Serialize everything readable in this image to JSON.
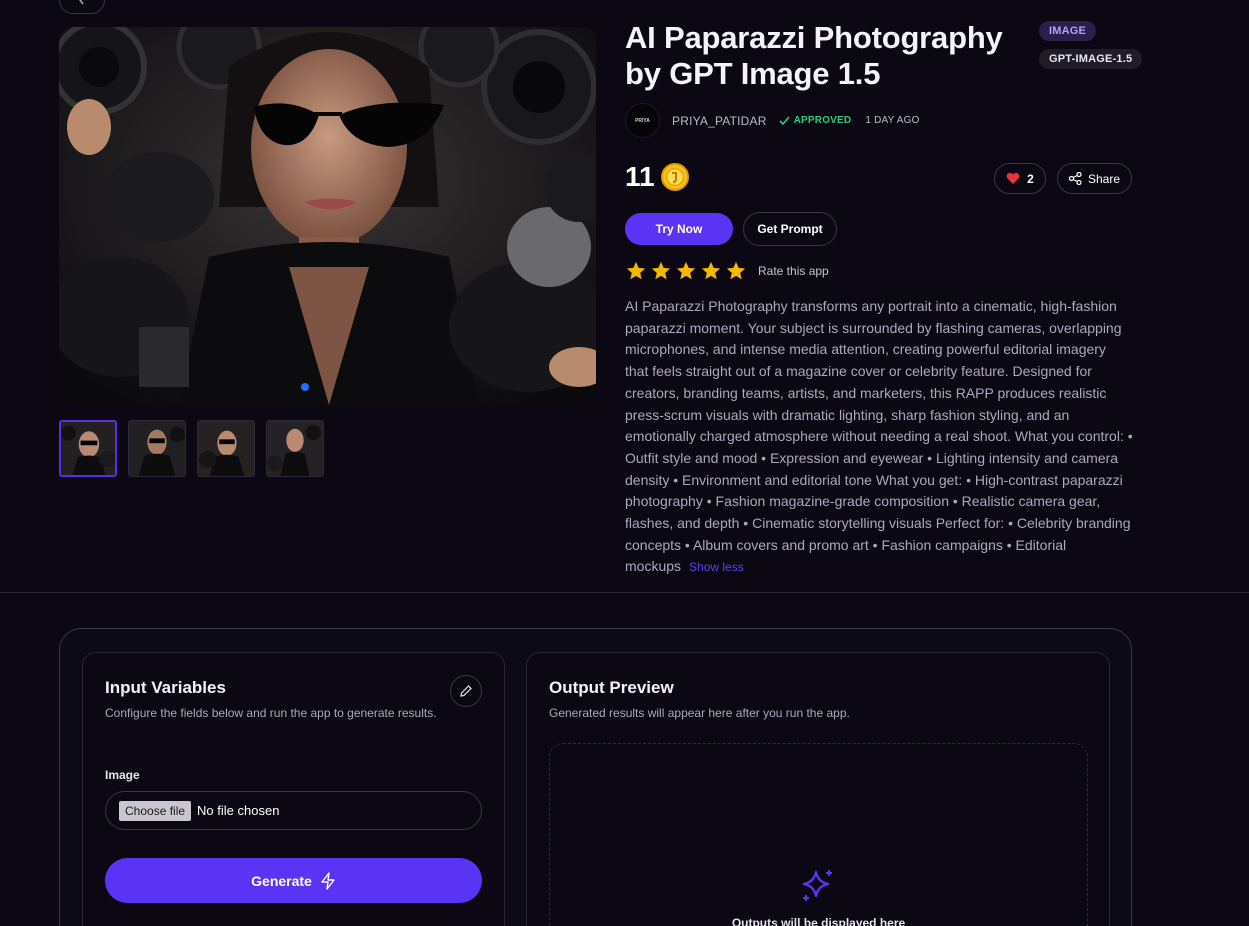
{
  "app": {
    "title": "AI Paparazzi Photography by GPT Image 1.5",
    "tags": [
      "IMAGE",
      "GPT-IMAGE-1.5"
    ]
  },
  "author": {
    "avatar_text": "PRIYA",
    "name": "PRIYA_PATIDAR",
    "status": "APPROVED",
    "posted": "1 DAY AGO"
  },
  "pricing": {
    "cost": "11",
    "currency_icon": "coin-icon"
  },
  "actions": {
    "likes": "2",
    "share_label": "Share",
    "try_label": "Try Now",
    "prompt_label": "Get Prompt"
  },
  "rating": {
    "stars": 5,
    "label": "Rate this app"
  },
  "description": {
    "text": "AI Paparazzi Photography transforms any portrait into a cinematic, high-fashion paparazzi moment. Your subject is surrounded by flashing cameras, overlapping microphones, and intense media attention, creating powerful editorial imagery that feels straight out of a magazine cover or celebrity feature. Designed for creators, branding teams, artists, and marketers, this RAPP produces realistic press-scrum visuals with dramatic lighting, sharp fashion styling, and an emotionally charged atmosphere without needing a real shoot. What you control: • Outfit style and mood • Expression and eyewear • Lighting intensity and camera density • Environment and editorial tone What you get: • High-contrast paparazzi photography • Fashion magazine-grade composition • Realistic camera gear, flashes, and depth • Cinematic storytelling visuals Perfect for: • Celebrity branding concepts • Album covers and promo art • Fashion campaigns • Editorial mockups",
    "toggle_label": "Show less"
  },
  "gallery": {
    "active_index": 0,
    "count": 4
  },
  "input_panel": {
    "title": "Input Variables",
    "subtitle": "Configure the fields below and run the app to generate results.",
    "field_label": "Image",
    "choose_label": "Choose file",
    "file_status": "No file chosen",
    "generate_label": "Generate"
  },
  "output_panel": {
    "title": "Output Preview",
    "subtitle": "Generated results will appear here after you run the app.",
    "placeholder": "Outputs will be displayed here"
  },
  "colors": {
    "accent": "#5a34f5",
    "background": "#0b0814",
    "approved": "#2ecc71",
    "star": "#f5b800",
    "heart": "#e8343f"
  }
}
